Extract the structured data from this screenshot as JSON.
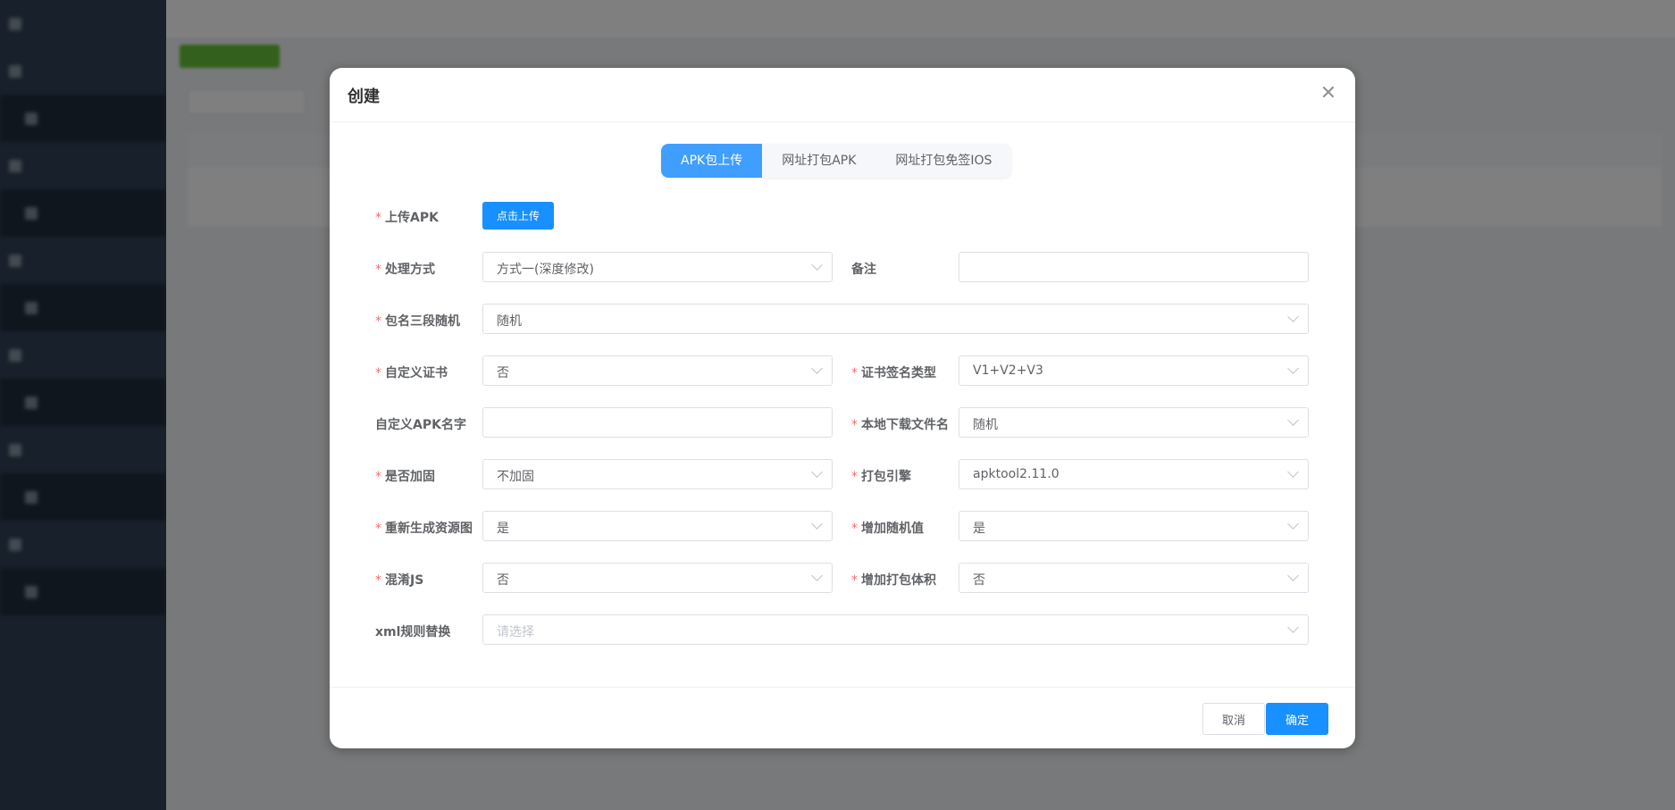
{
  "dialog": {
    "title": "创建",
    "tabs": [
      {
        "label": "APK包上传"
      },
      {
        "label": "网址打包APK"
      },
      {
        "label": "网址打包免签IOS"
      }
    ],
    "form": {
      "upload": {
        "label": "上传APK",
        "button": "点击上传"
      },
      "process_mode": {
        "label": "处理方式",
        "value": "方式一(深度修改)"
      },
      "remark": {
        "label": "备注",
        "value": ""
      },
      "pkg_random": {
        "label": "包名三段随机",
        "value": "随机"
      },
      "custom_cert": {
        "label": "自定义证书",
        "value": "否"
      },
      "sign_type": {
        "label": "证书签名类型",
        "value": "V1+V2+V3"
      },
      "apk_name": {
        "label": "自定义APK名字",
        "value": ""
      },
      "download_name": {
        "label": "本地下载文件名",
        "value": "随机"
      },
      "harden": {
        "label": "是否加固",
        "value": "不加固"
      },
      "engine": {
        "label": "打包引擎",
        "value": "apktool2.11.0"
      },
      "regen_res": {
        "label": "重新生成资源图",
        "value": "是"
      },
      "add_random": {
        "label": "增加随机值",
        "value": "是"
      },
      "obfuscate_js": {
        "label": "混淆JS",
        "value": "否"
      },
      "add_size": {
        "label": "增加打包体积",
        "value": "否"
      },
      "xml_rule": {
        "label": "xml规则替换",
        "placeholder": "请选择"
      }
    },
    "footer": {
      "cancel": "取消",
      "confirm": "确定"
    }
  },
  "colors": {
    "primary": "#1890ff",
    "required": "#f56c6c",
    "sidebar": "#304156"
  }
}
